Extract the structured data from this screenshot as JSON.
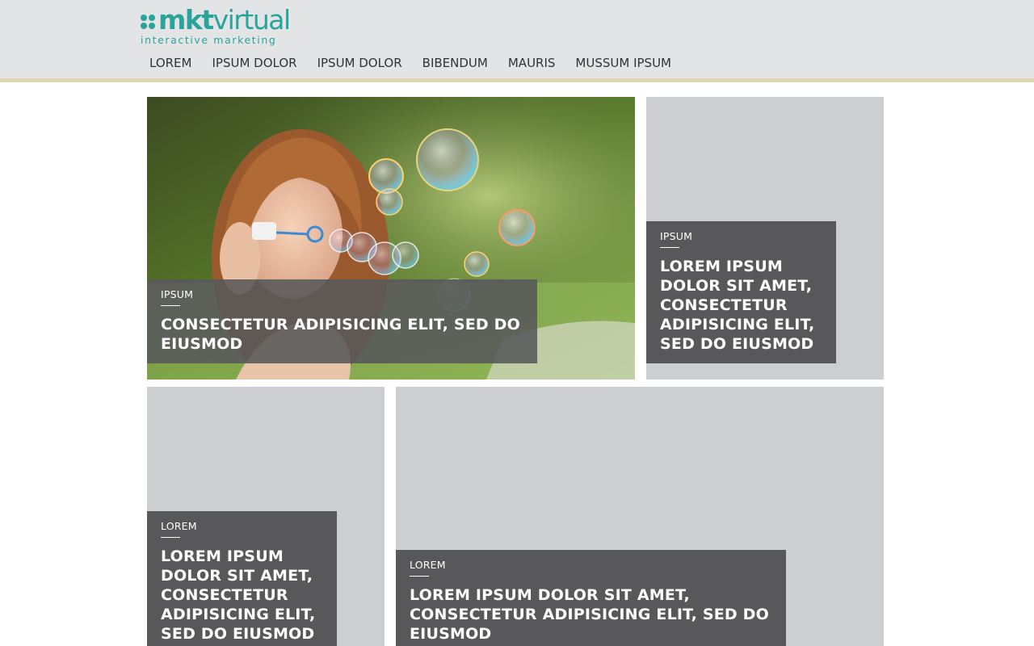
{
  "brand": {
    "name_bold": "mkt",
    "name_light": "virtual",
    "tagline": "interactive marketing",
    "color": "#2aa39a"
  },
  "nav": {
    "items": [
      {
        "label": "LOREM"
      },
      {
        "label": "IPSUM DOLOR"
      },
      {
        "label": "IPSUM DOLOR"
      },
      {
        "label": "BIBENDUM"
      },
      {
        "label": "MAURIS"
      },
      {
        "label": "MUSSUM IPSUM"
      }
    ]
  },
  "tiles": [
    {
      "category": "IPSUM",
      "headline": "CONSECTETUR ADIPISICING ELIT, SED DO EIUSMOD",
      "image": "woman-blowing-bubbles-photo"
    },
    {
      "category": "IPSUM",
      "headline": "LOREM IPSUM DOLOR SIT AMET, CONSECTETUR ADIPISICING ELIT, SED DO EIUSMOD"
    },
    {
      "category": "LOREM",
      "headline": "LOREM IPSUM DOLOR SIT AMET, CONSECTETUR ADIPISICING ELIT, SED DO EIUSMOD"
    },
    {
      "category": "LOREM",
      "headline": "LOREM IPSUM DOLOR SIT AMET, CONSECTETUR ADIPISICING ELIT, SED DO EIUSMOD"
    }
  ],
  "colors": {
    "header_bg": "#e3e4e6",
    "header_border": "#ddd6b4",
    "tile_bg": "#cdced1",
    "caption_bg": "#58585a"
  }
}
